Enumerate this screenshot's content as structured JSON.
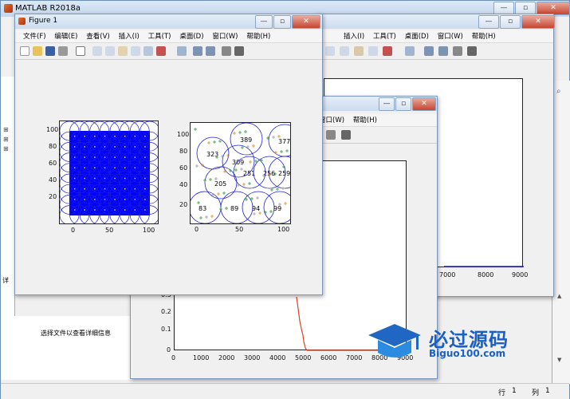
{
  "matlab": {
    "title": "MATLAB R2018a",
    "details_text": "选择文件以查看详细信息",
    "left_label": "详",
    "status_row_label": "行",
    "status_row": "1",
    "status_col_label": "列",
    "status_col": "1"
  },
  "figure1": {
    "title": "Figure 1",
    "menu": [
      "文件(F)",
      "编辑(E)",
      "查看(V)",
      "插入(I)",
      "工具(T)",
      "桌面(D)",
      "窗口(W)",
      "帮助(H)"
    ]
  },
  "back_figure": {
    "menu": [
      "插入(I)",
      "工具(T)",
      "桌面(D)",
      "窗口(W)",
      "帮助(H)"
    ]
  },
  "mid_figure": {
    "menu": [
      "窗口(W)",
      "帮助(H)"
    ]
  },
  "plot_left": {
    "yticks": [
      "100",
      "80",
      "60",
      "40",
      "20"
    ],
    "xticks": [
      "0",
      "50",
      "100"
    ]
  },
  "plot_right": {
    "yticks": [
      "100",
      "80",
      "60",
      "40",
      "20"
    ],
    "xticks": [
      "0",
      "50",
      "100"
    ],
    "labels": [
      "323",
      "389",
      "377",
      "309",
      "251",
      "256",
      "259",
      "205",
      "83",
      "89",
      "94",
      "99"
    ]
  },
  "back_axes": {
    "xticks": [
      "7000",
      "8000",
      "9000"
    ]
  },
  "bottom_axes": {
    "yticks": [
      "0.3",
      "0.2",
      "0.1",
      "0"
    ],
    "xticks": [
      "0",
      "1000",
      "2000",
      "3000",
      "4000",
      "5000",
      "6000",
      "7000",
      "8000",
      "9000"
    ]
  },
  "watermark": {
    "name": "必过源码",
    "url": "Biguo100.com"
  },
  "colors": {
    "circle": "#1f1fd0",
    "fill": "#0000ff",
    "line": "#d9441c",
    "axis": "#1f1fd0"
  }
}
